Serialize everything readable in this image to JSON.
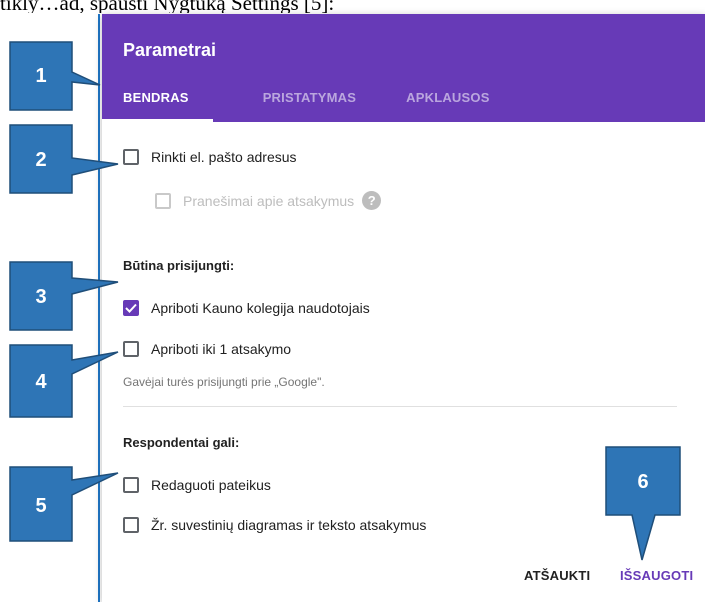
{
  "caption": "tikly…ad, spausti Nygtuką Settings [5]:",
  "dialog": {
    "title": "Parametrai",
    "tabs": [
      {
        "label": "BENDRAS",
        "active": true
      },
      {
        "label": "PRISTATYMAS",
        "active": false
      },
      {
        "label": "APKLAUSOS",
        "active": false
      }
    ]
  },
  "options": {
    "collect_email": {
      "label": "Rinkti el. pašto adresus",
      "checked": false
    },
    "response_receipts": {
      "label": "Pranešimai apie atsakymus",
      "checked": false,
      "disabled": true
    }
  },
  "requires_signin": {
    "title": "Būtina prisijungti:",
    "restrict_org": {
      "label": "Apriboti Kauno kolegija naudotojais",
      "checked": true
    },
    "limit_one": {
      "label": "Apriboti iki 1 atsakymo",
      "checked": false
    },
    "hint": "Gavėjai turės prisijungti prie „Google\"."
  },
  "respondents": {
    "title": "Respondentai gali:",
    "edit_after": {
      "label": "Redaguoti pateikus",
      "checked": false
    },
    "see_summary": {
      "label": "Žr. suvestinių diagramas ir teksto atsakymus",
      "checked": false
    }
  },
  "footer": {
    "cancel": "ATŠAUKTI",
    "save": "IŠSAUGOTI"
  },
  "callouts": [
    "1",
    "2",
    "3",
    "4",
    "5",
    "6"
  ],
  "colors": {
    "header": "#673ab7",
    "callout_fill": "#2e75b6",
    "callout_border": "#1f4e79"
  },
  "icons": {
    "help": "help-circle-icon",
    "check": "check-icon"
  }
}
